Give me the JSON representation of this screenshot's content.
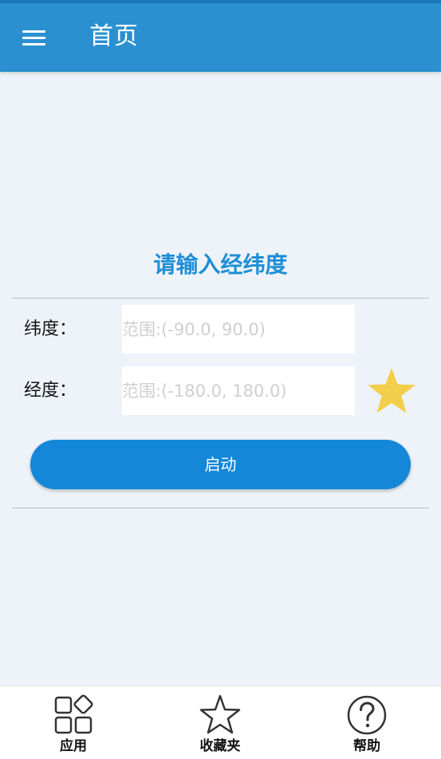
{
  "appbar": {
    "menu_icon": "hamburger-menu-icon",
    "title": "首页"
  },
  "form": {
    "title": "请输入经纬度",
    "latitude": {
      "label": "纬度：",
      "value": "",
      "placeholder": "范围:(-90.0, 90.0)"
    },
    "longitude": {
      "label": "经度：",
      "value": "",
      "placeholder": "范围:(-180.0, 180.0)"
    },
    "favorite_icon": "star-icon",
    "start_label": "启动"
  },
  "bottom_nav": {
    "items": [
      {
        "label": "应用",
        "icon": "apps-icon"
      },
      {
        "label": "收藏夹",
        "icon": "star-outline-icon"
      },
      {
        "label": "帮助",
        "icon": "help-icon"
      }
    ]
  },
  "colors": {
    "primary": "#2A90D0",
    "accent_button": "#1487D8",
    "title_text": "#1E8ED6",
    "star": "#F2CE4A",
    "background": "#EEF3F9"
  }
}
